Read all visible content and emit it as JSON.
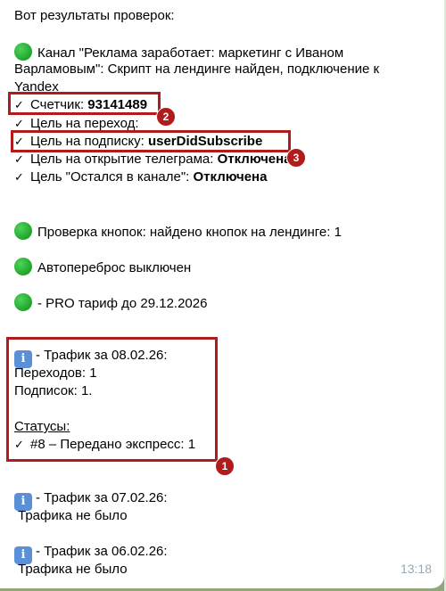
{
  "message": {
    "intro": "Вот результаты проверок:",
    "channel_line1": "Канал \"Реклама заработает: маркетинг с Иваном",
    "channel_line2": "Варламовым\": Скрипт на лендинге найден, подключение к",
    "channel_line3": "Yandex",
    "counter_label": "Счетчик:",
    "counter_value": "93141489",
    "goal_transition": "Цель на переход:",
    "goal_subscribe_label": "Цель на подписку:",
    "goal_subscribe_value": "userDidSubscribe",
    "goal_telegram_label": "Цель на открытие телеграма:",
    "goal_telegram_value": "Отключена",
    "goal_stayed_label": "Цель \"Остался в канале\":",
    "goal_stayed_value": "Отключена",
    "buttons_check": "Проверка кнопок: найдено кнопок на лендинге: 1",
    "autoforward": "Автопереброс выключен",
    "pro_tariff": "- PRO тариф до 29.12.2026",
    "traffic1_title": "- Трафик за 08.02.26:",
    "traffic1_visits": "Переходов: 1",
    "traffic1_subs": "Подписок: 1.",
    "statuses_label": "Статусы:",
    "status_item": "#8 – Передано экспресс: 1",
    "traffic2_title": "- Трафик за 07.02.26:",
    "traffic2_none": "Трафика не было",
    "traffic3_title": "- Трафик за 06.02.26:",
    "traffic3_none": "Трафика не было",
    "time": "13:18"
  },
  "annotations": {
    "badge1": "1",
    "badge2": "2",
    "badge3": "3"
  },
  "icons": {
    "check": "✓",
    "info": "i",
    "green_circle": "green-circle"
  },
  "colors": {
    "annotation_red": "#b01c1c",
    "green": "#1ea52a",
    "info_blue": "#5b8fd6",
    "background": "#8fa77a"
  }
}
